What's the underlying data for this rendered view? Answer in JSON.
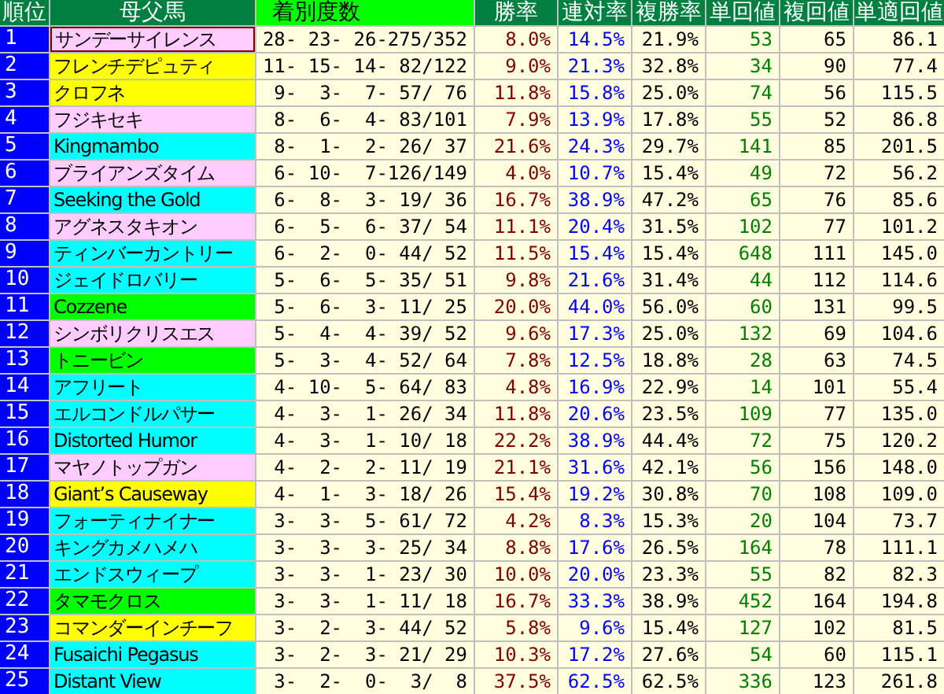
{
  "columns": [
    {
      "label": "順位",
      "kind": "dark"
    },
    {
      "label": "母父馬",
      "kind": "dark"
    },
    {
      "label": "着別度数",
      "kind": "bright"
    },
    {
      "label": "勝率",
      "kind": "dark"
    },
    {
      "label": "連対率",
      "kind": "dark"
    },
    {
      "label": "複勝率",
      "kind": "dark"
    },
    {
      "label": "単回値",
      "kind": "dark"
    },
    {
      "label": "複回値",
      "kind": "dark"
    },
    {
      "label": "単適回値",
      "kind": "dark"
    }
  ],
  "rows": [
    {
      "rank": "1",
      "name": "サンデーサイレンス",
      "color": "#ffccff",
      "selected": true,
      "record": "28- 23- 26-275/352",
      "win": "8.0%",
      "quinella": "14.5%",
      "show": "21.9%",
      "win_return": "53",
      "show_return": "65",
      "adj_return": "86.1"
    },
    {
      "rank": "2",
      "name": "フレンチデピュティ",
      "color": "#ffff00",
      "selected": false,
      "record": "11- 15- 14- 82/122",
      "win": "9.0%",
      "quinella": "21.3%",
      "show": "32.8%",
      "win_return": "34",
      "show_return": "90",
      "adj_return": "77.4"
    },
    {
      "rank": "3",
      "name": "クロフネ",
      "color": "#ffff00",
      "selected": false,
      "record": "9-  3-  7- 57/ 76",
      "win": "11.8%",
      "quinella": "15.8%",
      "show": "25.0%",
      "win_return": "74",
      "show_return": "56",
      "adj_return": "115.5"
    },
    {
      "rank": "4",
      "name": "フジキセキ",
      "color": "#ffccff",
      "selected": false,
      "record": "8-  6-  4- 83/101",
      "win": "7.9%",
      "quinella": "13.9%",
      "show": "17.8%",
      "win_return": "55",
      "show_return": "52",
      "adj_return": "86.8"
    },
    {
      "rank": "5",
      "name": "Kingmambo",
      "color": "#00ffff",
      "selected": false,
      "record": "8-  1-  2- 26/ 37",
      "win": "21.6%",
      "quinella": "24.3%",
      "show": "29.7%",
      "win_return": "141",
      "show_return": "85",
      "adj_return": "201.5"
    },
    {
      "rank": "6",
      "name": "ブライアンズタイム",
      "color": "#ffccff",
      "selected": false,
      "record": "6- 10-  7-126/149",
      "win": "4.0%",
      "quinella": "10.7%",
      "show": "15.4%",
      "win_return": "49",
      "show_return": "72",
      "adj_return": "56.2"
    },
    {
      "rank": "7",
      "name": "Seeking the Gold",
      "color": "#00ffff",
      "selected": false,
      "record": "6-  8-  3- 19/ 36",
      "win": "16.7%",
      "quinella": "38.9%",
      "show": "47.2%",
      "win_return": "65",
      "show_return": "76",
      "adj_return": "85.6"
    },
    {
      "rank": "8",
      "name": "アグネスタキオン",
      "color": "#ffccff",
      "selected": false,
      "record": "6-  5-  6- 37/ 54",
      "win": "11.1%",
      "quinella": "20.4%",
      "show": "31.5%",
      "win_return": "102",
      "show_return": "77",
      "adj_return": "101.2"
    },
    {
      "rank": "9",
      "name": "ティンバーカントリー",
      "color": "#00ffff",
      "selected": false,
      "record": "6-  2-  0- 44/ 52",
      "win": "11.5%",
      "quinella": "15.4%",
      "show": "15.4%",
      "win_return": "648",
      "show_return": "111",
      "adj_return": "145.0"
    },
    {
      "rank": "10",
      "name": "ジェイドロバリー",
      "color": "#00ffff",
      "selected": false,
      "record": "5-  6-  5- 35/ 51",
      "win": "9.8%",
      "quinella": "21.6%",
      "show": "31.4%",
      "win_return": "44",
      "show_return": "112",
      "adj_return": "114.6"
    },
    {
      "rank": "11",
      "name": "Cozzene",
      "color": "#00ff00",
      "selected": false,
      "record": "5-  6-  3- 11/ 25",
      "win": "20.0%",
      "quinella": "44.0%",
      "show": "56.0%",
      "win_return": "60",
      "show_return": "131",
      "adj_return": "99.5"
    },
    {
      "rank": "12",
      "name": "シンボリクリスエス",
      "color": "#ffccff",
      "selected": false,
      "record": "5-  4-  4- 39/ 52",
      "win": "9.6%",
      "quinella": "17.3%",
      "show": "25.0%",
      "win_return": "132",
      "show_return": "69",
      "adj_return": "104.6"
    },
    {
      "rank": "13",
      "name": "トニービン",
      "color": "#00ff00",
      "selected": false,
      "record": "5-  3-  4- 52/ 64",
      "win": "7.8%",
      "quinella": "12.5%",
      "show": "18.8%",
      "win_return": "28",
      "show_return": "63",
      "adj_return": "74.5"
    },
    {
      "rank": "14",
      "name": "アフリート",
      "color": "#00ffff",
      "selected": false,
      "record": "4- 10-  5- 64/ 83",
      "win": "4.8%",
      "quinella": "16.9%",
      "show": "22.9%",
      "win_return": "14",
      "show_return": "101",
      "adj_return": "55.4"
    },
    {
      "rank": "15",
      "name": "エルコンドルパサー",
      "color": "#00ffff",
      "selected": false,
      "record": "4-  3-  1- 26/ 34",
      "win": "11.8%",
      "quinella": "20.6%",
      "show": "23.5%",
      "win_return": "109",
      "show_return": "77",
      "adj_return": "135.0"
    },
    {
      "rank": "16",
      "name": "Distorted Humor",
      "color": "#00ffff",
      "selected": false,
      "record": "4-  3-  1- 10/ 18",
      "win": "22.2%",
      "quinella": "38.9%",
      "show": "44.4%",
      "win_return": "72",
      "show_return": "75",
      "adj_return": "120.2"
    },
    {
      "rank": "17",
      "name": "マヤノトップガン",
      "color": "#ffccff",
      "selected": false,
      "record": "4-  2-  2- 11/ 19",
      "win": "21.1%",
      "quinella": "31.6%",
      "show": "42.1%",
      "win_return": "56",
      "show_return": "156",
      "adj_return": "148.0"
    },
    {
      "rank": "18",
      "name": "Giant’s Causeway",
      "color": "#ffff00",
      "selected": false,
      "record": "4-  1-  3- 18/ 26",
      "win": "15.4%",
      "quinella": "19.2%",
      "show": "30.8%",
      "win_return": "70",
      "show_return": "108",
      "adj_return": "109.0"
    },
    {
      "rank": "19",
      "name": "フォーティナイナー",
      "color": "#00ffff",
      "selected": false,
      "record": "3-  3-  5- 61/ 72",
      "win": "4.2%",
      "quinella": "8.3%",
      "show": "15.3%",
      "win_return": "20",
      "show_return": "104",
      "adj_return": "73.7"
    },
    {
      "rank": "20",
      "name": "キングカメハメハ",
      "color": "#00ffff",
      "selected": false,
      "record": "3-  3-  3- 25/ 34",
      "win": "8.8%",
      "quinella": "17.6%",
      "show": "26.5%",
      "win_return": "164",
      "show_return": "78",
      "adj_return": "111.1"
    },
    {
      "rank": "21",
      "name": "エンドスウィープ",
      "color": "#00ffff",
      "selected": false,
      "record": "3-  3-  1- 23/ 30",
      "win": "10.0%",
      "quinella": "20.0%",
      "show": "23.3%",
      "win_return": "55",
      "show_return": "82",
      "adj_return": "82.3"
    },
    {
      "rank": "22",
      "name": "タマモクロス",
      "color": "#00ff00",
      "selected": false,
      "record": "3-  3-  1- 11/ 18",
      "win": "16.7%",
      "quinella": "33.3%",
      "show": "38.9%",
      "win_return": "452",
      "show_return": "164",
      "adj_return": "194.8"
    },
    {
      "rank": "23",
      "name": "コマンダーインチーフ",
      "color": "#ffff00",
      "selected": false,
      "record": "3-  2-  3- 44/ 52",
      "win": "5.8%",
      "quinella": "9.6%",
      "show": "15.4%",
      "win_return": "127",
      "show_return": "102",
      "adj_return": "81.5"
    },
    {
      "rank": "24",
      "name": "Fusaichi Pegasus",
      "color": "#00ffff",
      "selected": false,
      "record": "3-  2-  3- 21/ 29",
      "win": "10.3%",
      "quinella": "17.2%",
      "show": "27.6%",
      "win_return": "54",
      "show_return": "60",
      "adj_return": "115.1"
    },
    {
      "rank": "25",
      "name": "Distant View",
      "color": "#00ffff",
      "selected": false,
      "record": "3-  2-  0-  3/  8",
      "win": "37.5%",
      "quinella": "62.5%",
      "show": "62.5%",
      "win_return": "336",
      "show_return": "123",
      "adj_return": "261.8"
    }
  ]
}
